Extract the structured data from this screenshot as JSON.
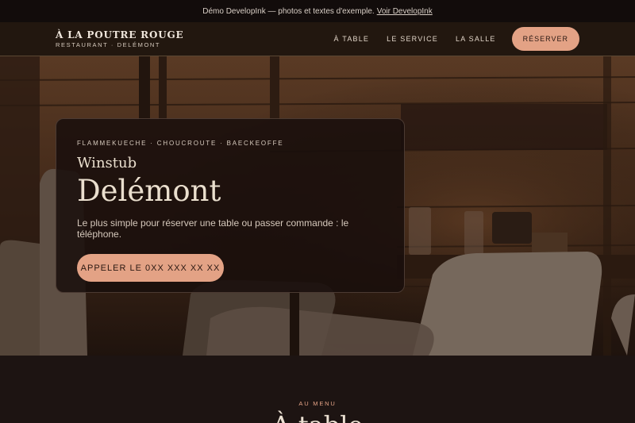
{
  "demo_bar": {
    "text": "Démo DevelopInk — photos et textes d'exemple.",
    "link": "Voir DevelopInk"
  },
  "brand": {
    "name": "À LA POUTRE ROUGE",
    "sub": "RESTAURANT · DELÉMONT"
  },
  "nav": {
    "items": [
      "À TABLE",
      "LE SERVICE",
      "LA SALLE"
    ],
    "cta": "RÉSERVER"
  },
  "hero": {
    "tagline": "FLAMMEKUECHE · CHOUCROUTE · BAECKEOFFE",
    "kicker": "Winstub",
    "title": "Delémont",
    "lede": "Le plus simple pour réserver une table ou passer commande : le téléphone.",
    "cta": "APPELER LE 0XX XXX XX XX"
  },
  "menu_section": {
    "eyebrow": "AU MENU",
    "title": "À table"
  },
  "colors": {
    "accent": "#e3a285",
    "background": "#1e1513",
    "text": "#eadfce"
  }
}
